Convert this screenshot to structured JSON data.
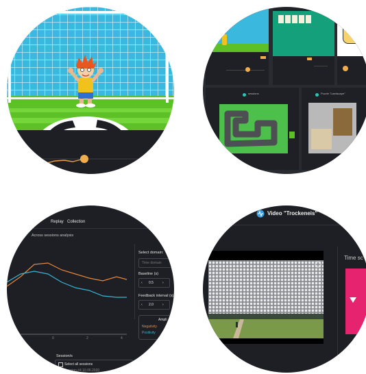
{
  "games_grid": {
    "mini_titles": [
      "sessions",
      "Puzzle \"Landscape\""
    ]
  },
  "analysis_panel": {
    "tabs": [
      "Replay",
      "Collection"
    ],
    "heading": "Across sessions analysis",
    "select_domain_label": "Select domain:",
    "select_domain_placeholder": "Time domain",
    "baseline_label": "Baseline (s)",
    "baseline_value": "0.5",
    "feedback_label": "Feedback interval (s)",
    "feedback_value": "2.0",
    "amplitude_label": "Ampli",
    "legend_negativity": "Negativity",
    "legend_positivity": "Positivity",
    "x_ticks": [
      "0",
      "2",
      "4"
    ],
    "sessions_label": "Session/s",
    "select_all_label": "Select all sessions",
    "session_item": "Session #4 10.06.2020",
    "colors": {
      "orange": "#e8873a",
      "blue": "#38b6d8"
    }
  },
  "video_panel": {
    "title": "Video \"Trockeneis\"",
    "side_label": "Time sc",
    "colors": {
      "accent": "#e6236f",
      "logo": "#3a9fe0"
    }
  }
}
